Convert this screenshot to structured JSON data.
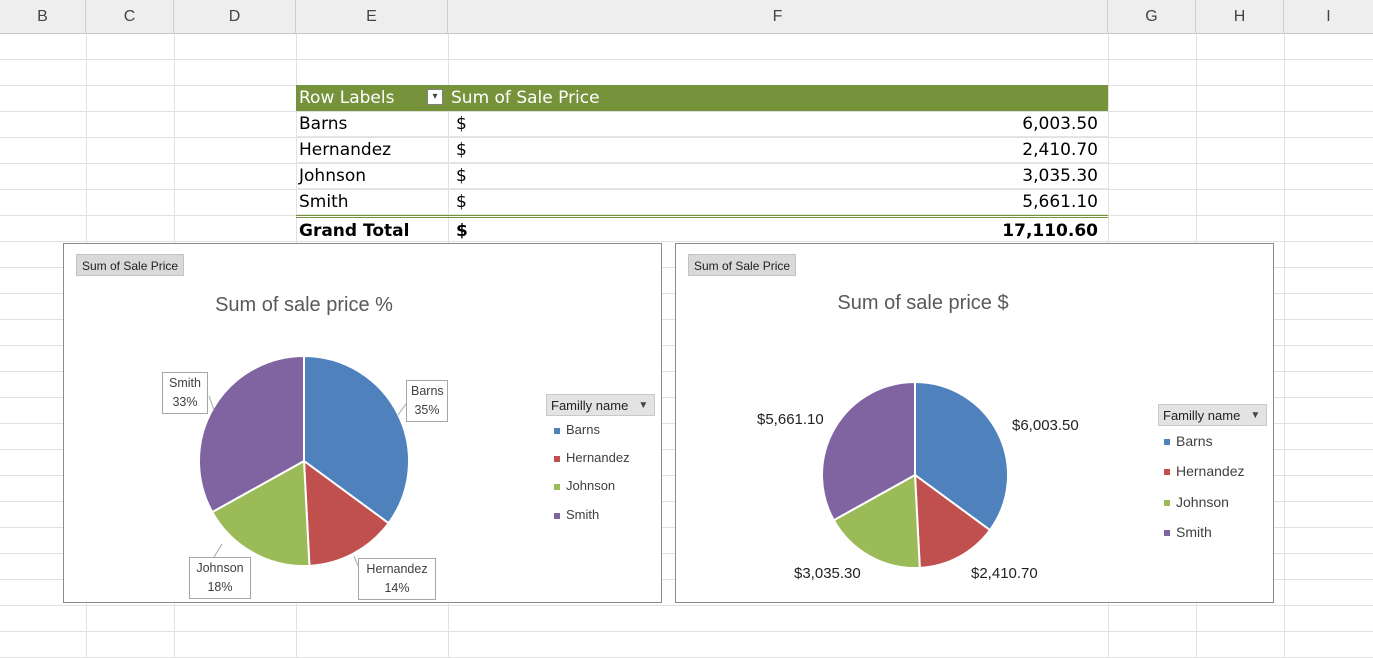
{
  "columns": [
    "B",
    "C",
    "D",
    "E",
    "F",
    "G",
    "H",
    "I"
  ],
  "pivot": {
    "header_label": "Row Labels",
    "header_value": "Sum of Sale Price",
    "rows": [
      {
        "label": "Barns",
        "currency": "$",
        "value": "6,003.50"
      },
      {
        "label": "Hernandez",
        "currency": "$",
        "value": "2,410.70"
      },
      {
        "label": "Johnson",
        "currency": "$",
        "value": "3,035.30"
      },
      {
        "label": "Smith",
        "currency": "$",
        "value": "5,661.10"
      }
    ],
    "total": {
      "label": "Grand Total",
      "currency": "$",
      "value": "17,110.60"
    }
  },
  "colors": {
    "Barns": "#4f81bd",
    "Hernandez": "#c0504d",
    "Johnson": "#9bbb59",
    "Smith": "#8064a2",
    "header_bg": "#76933c"
  },
  "chart_data": [
    {
      "type": "pie",
      "field_button": "Sum of Sale Price",
      "title": "Sum of sale price %",
      "legend_title": "Familly name",
      "legend_position": "right",
      "categories": [
        "Barns",
        "Hernandez",
        "Johnson",
        "Smith"
      ],
      "values": [
        6003.5,
        2410.7,
        3035.3,
        5661.1
      ],
      "data_labels": [
        {
          "name": "Barns",
          "pct": "35%"
        },
        {
          "name": "Hernandez",
          "pct": "14%"
        },
        {
          "name": "Johnson",
          "pct": "18%"
        },
        {
          "name": "Smith",
          "pct": "33%"
        }
      ]
    },
    {
      "type": "pie",
      "field_button": "Sum of Sale Price",
      "title": "Sum of sale price $",
      "legend_title": "Familly name",
      "legend_position": "right",
      "categories": [
        "Barns",
        "Hernandez",
        "Johnson",
        "Smith"
      ],
      "values": [
        6003.5,
        2410.7,
        3035.3,
        5661.1
      ],
      "data_labels": [
        "$6,003.50",
        "$2,410.70",
        "$3,035.30",
        "$5,661.10"
      ]
    }
  ]
}
